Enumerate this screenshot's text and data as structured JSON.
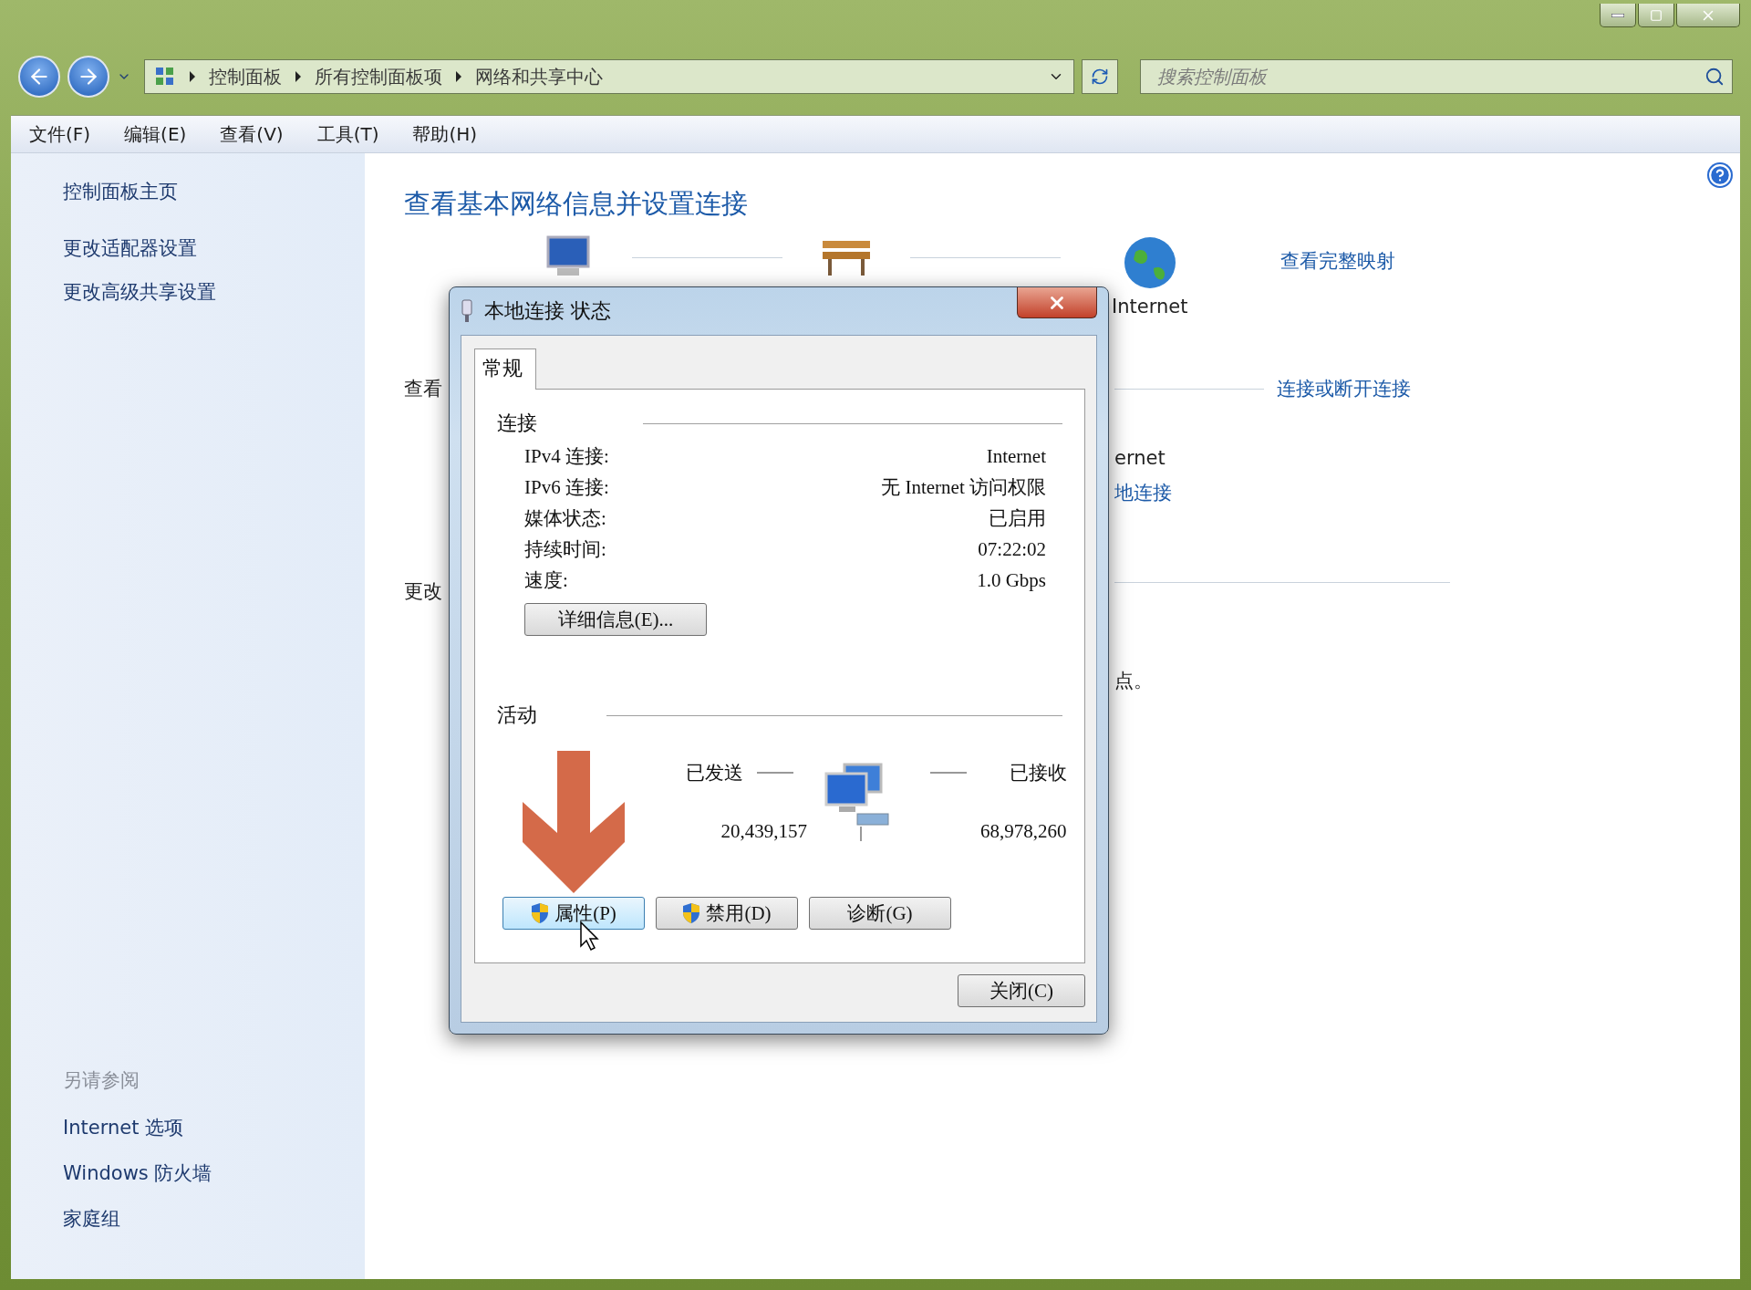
{
  "address_bar": {
    "breadcrumbs": [
      "控制面板",
      "所有控制面板项",
      "网络和共享中心"
    ]
  },
  "search": {
    "placeholder": "搜索控制面板"
  },
  "menu_bar": [
    "文件(F)",
    "编辑(E)",
    "查看(V)",
    "工具(T)",
    "帮助(H)"
  ],
  "sidebar": {
    "items": [
      "控制面板主页",
      "更改适配器设置",
      "更改高级共享设置"
    ],
    "see_also": {
      "heading": "另请参阅",
      "items": [
        "Internet 选项",
        "Windows 防火墙",
        "家庭组"
      ]
    }
  },
  "main": {
    "title": "查看基本网络信息并设置连接",
    "map_label": "Internet",
    "map_link": "查看完整映射",
    "section_1": "查看",
    "section_1_link": "连接或断开连接",
    "network_name": "ernet",
    "connection_link": "地连接",
    "section_2": "更改",
    "section_2_text": "点。"
  },
  "dialog": {
    "title": "本地连接 状态",
    "tabs": [
      {
        "label": "常规",
        "selected": true
      }
    ],
    "connection": {
      "heading": "连接",
      "rows": [
        {
          "label": "IPv4 连接:",
          "value": "Internet"
        },
        {
          "label": "IPv6 连接:",
          "value": "无 Internet 访问权限"
        },
        {
          "label": "媒体状态:",
          "value": "已启用"
        },
        {
          "label": "持续时间:",
          "value": "07:22:02"
        },
        {
          "label": "速度:",
          "value": "1.0 Gbps"
        }
      ],
      "details_button": "详细信息(E)..."
    },
    "activity": {
      "heading": "活动",
      "sent_label": "已发送",
      "received_label": "已接收",
      "sent": "20,439,157",
      "received": "68,978,260"
    },
    "buttons": [
      {
        "label": "属性(P)",
        "kind": "shield",
        "highlighted": true
      },
      {
        "label": "禁用(D)",
        "kind": "shield",
        "highlighted": false
      },
      {
        "label": "诊断(G)",
        "kind": "plain",
        "highlighted": false
      }
    ],
    "close_button": "关闭(C)"
  }
}
